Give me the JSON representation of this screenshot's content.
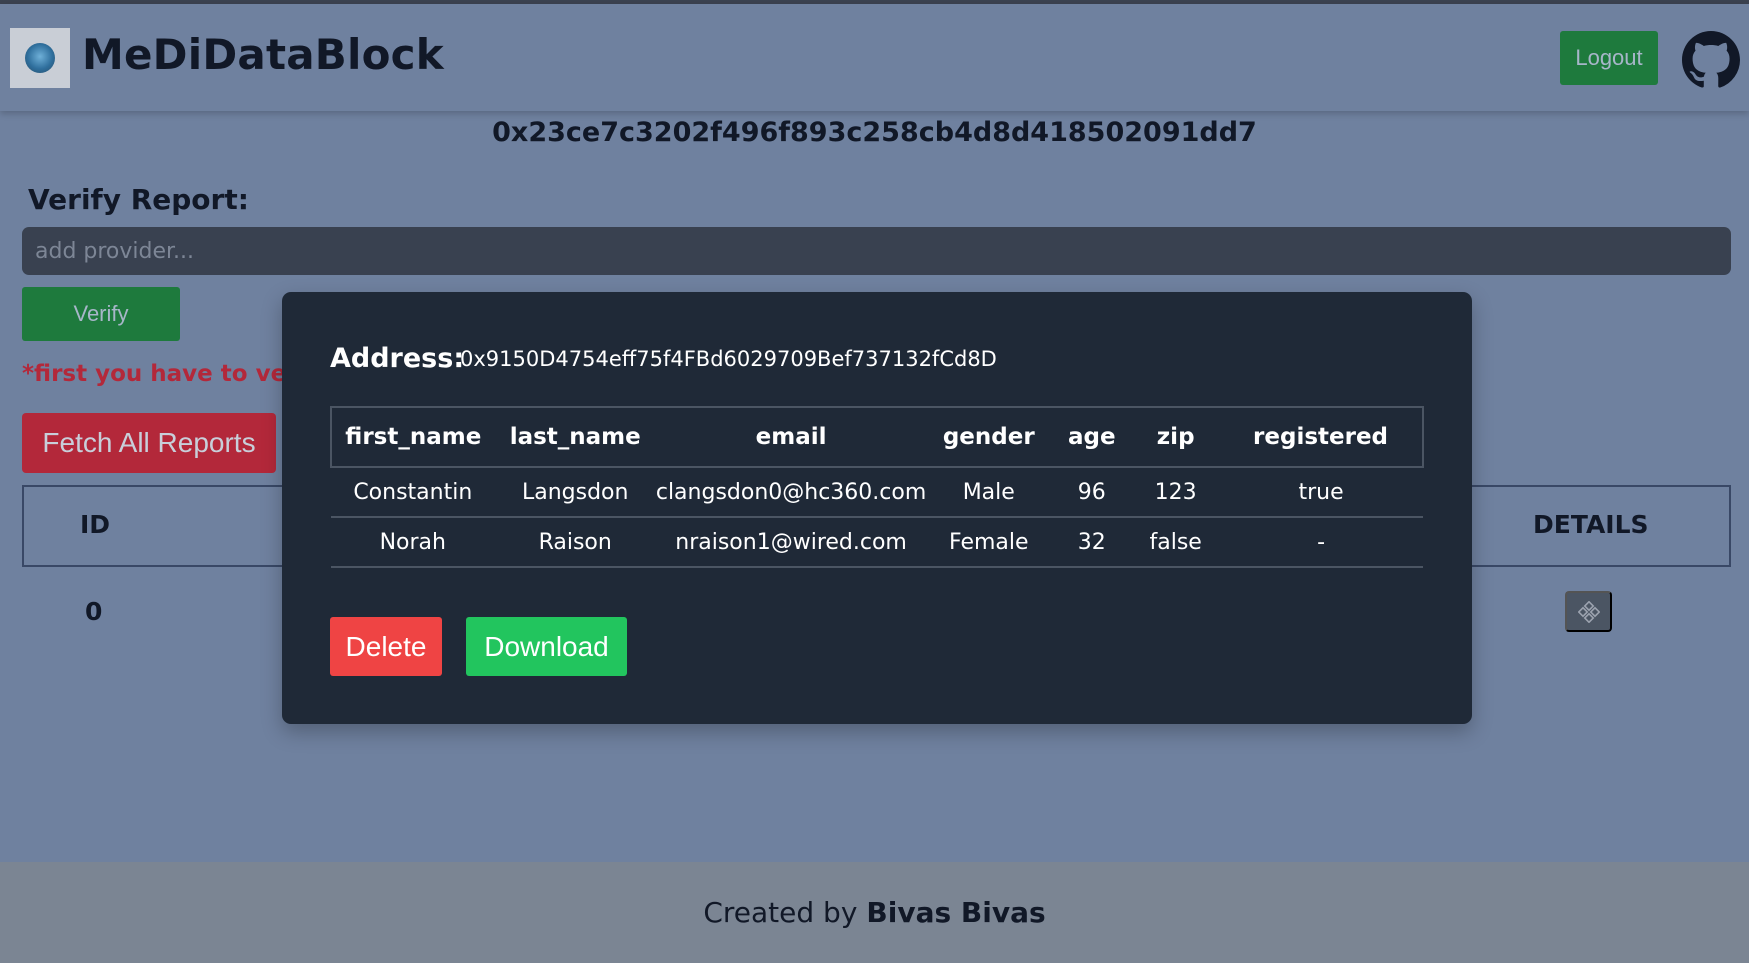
{
  "app": {
    "title": "MeDiDataBlock",
    "logout_label": "Logout"
  },
  "account": {
    "address": "0x23ce7c3202f496f893c258cb4d8d418502091dd7"
  },
  "verify": {
    "label": "Verify Report:",
    "placeholder": "add provider...",
    "button_label": "Verify",
    "warning": "*first you have to verify"
  },
  "reports": {
    "fetch_label": "Fetch All Reports",
    "columns": {
      "id": "ID",
      "details": "DETAILS"
    },
    "rows": [
      {
        "id": "0"
      }
    ]
  },
  "modal": {
    "address_label": "Address:",
    "address_value": "0x9150D4754eff75f4FBd6029709Bef737132fCd8D",
    "columns": [
      "first_name",
      "last_name",
      "email",
      "gender",
      "age",
      "zip",
      "registered"
    ],
    "rows": [
      [
        "Constantin",
        "Langsdon",
        "clangsdon0@hc360.com",
        "Male",
        "96",
        "123",
        "true"
      ],
      [
        "Norah",
        "Raison",
        "nraison1@wired.com",
        "Female",
        "32",
        "false",
        "-"
      ]
    ],
    "delete_label": "Delete",
    "download_label": "Download"
  },
  "footer": {
    "prefix": "Created by",
    "author": "Bivas Bivas"
  },
  "colors": {
    "background": "#6f819f",
    "modal": "#1f2937",
    "green": "#1e7a3d",
    "red": "#b3283a",
    "delete": "#ef4444",
    "download": "#22c55e"
  },
  "icons": [
    "logo-icon",
    "github-icon",
    "details-icon"
  ]
}
